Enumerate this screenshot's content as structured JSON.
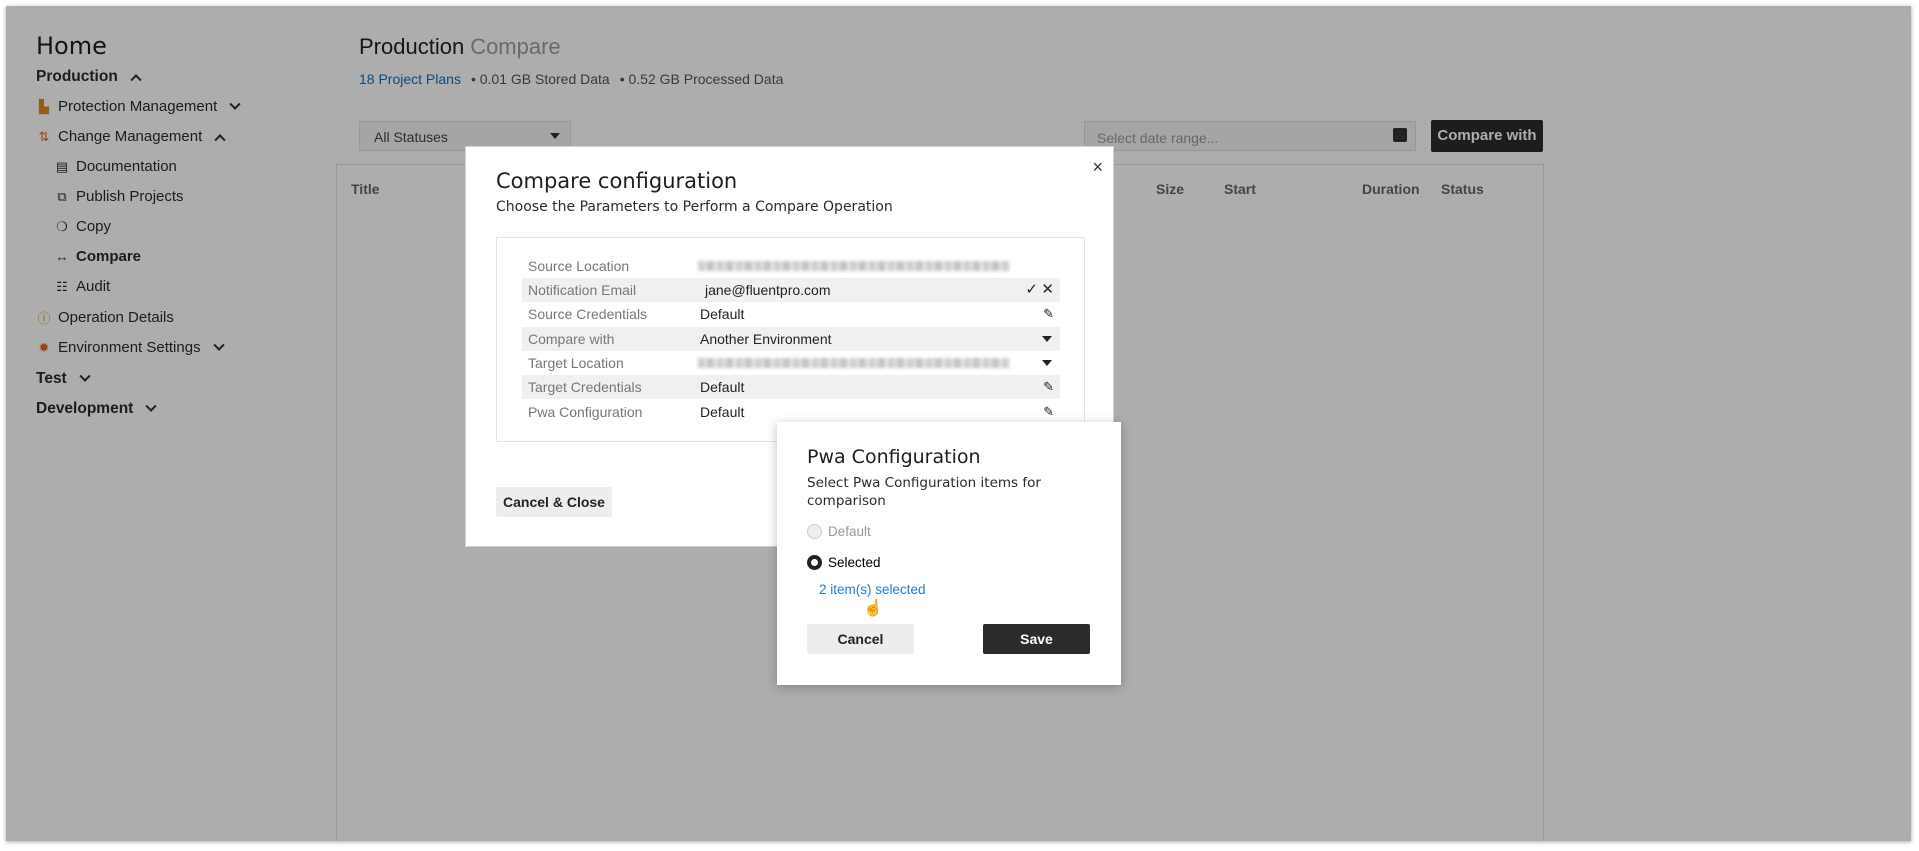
{
  "sidebar": {
    "home": "Home",
    "production": "Production",
    "protection_management": "Protection Management",
    "change_management": "Change Management",
    "sub_items": [
      "Documentation",
      "Publish Projects",
      "Copy",
      "Compare",
      "Audit"
    ],
    "operation_details": "Operation Details",
    "environment_settings": "Environment Settings",
    "test": "Test",
    "development": "Development"
  },
  "header": {
    "title": "Production",
    "subtitle": "Compare",
    "project_plans": "18 Project Plans",
    "stored": "• 0.01 GB Stored Data",
    "processed": "• 0.52 GB Processed Data"
  },
  "toolbar": {
    "status_filter": "All Statuses",
    "date_placeholder": "Select date range...",
    "compare_with": "Compare with"
  },
  "table": {
    "columns": [
      "Title",
      "Size",
      "Start",
      "Duration",
      "Status"
    ]
  },
  "modal": {
    "title": "Compare configuration",
    "description": "Choose the Parameters to Perform a Compare Operation",
    "close": "×",
    "rows": [
      {
        "label": "Source Location",
        "value": ""
      },
      {
        "label": "Notification Email",
        "value": "jane@fluentpro.com"
      },
      {
        "label": "Source Credentials",
        "value": "Default"
      },
      {
        "label": "Compare with",
        "value": "Another Environment"
      },
      {
        "label": "Target Location",
        "value": ""
      },
      {
        "label": "Target Credentials",
        "value": "Default"
      },
      {
        "label": "Pwa Configuration",
        "value": "Default"
      }
    ],
    "cancel_close": "Cancel & Close"
  },
  "pwa": {
    "title": "Pwa Configuration",
    "description": "Select Pwa Configuration items for comparison",
    "option_default": "Default",
    "option_selected": "Selected",
    "selected_link": "2 item(s) selected",
    "cancel": "Cancel",
    "save": "Save"
  }
}
